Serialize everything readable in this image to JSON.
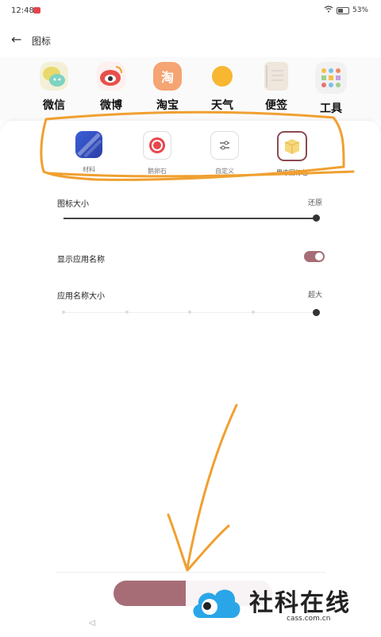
{
  "status": {
    "time": "12:48",
    "battery": "53%"
  },
  "header": {
    "title": "图标"
  },
  "preview_apps": [
    {
      "label": "微信",
      "icon": "wechat-icon"
    },
    {
      "label": "微博",
      "icon": "weibo-icon"
    },
    {
      "label": "淘宝",
      "icon": "taobao-icon",
      "glyph": "淘"
    },
    {
      "label": "天气",
      "icon": "weather-icon"
    },
    {
      "label": "便签",
      "icon": "notes-icon"
    },
    {
      "label": "工具",
      "icon": "tools-icon"
    }
  ],
  "icon_styles": [
    {
      "label": "材料",
      "icon": "material-style-icon"
    },
    {
      "label": "鹅卵石",
      "icon": "pebble-style-icon"
    },
    {
      "label": "自定义",
      "icon": "custom-style-icon"
    },
    {
      "label": "果冻图标包",
      "icon": "jelly-pack-icon"
    }
  ],
  "settings": {
    "icon_size_label": "图标大小",
    "icon_size_reset": "还原",
    "icon_size_value": 1.0,
    "show_name_label": "显示应用名称",
    "show_name_enabled": true,
    "name_size_label": "应用名称大小",
    "name_size_value": "超大",
    "name_size_step": 5,
    "name_size_steps": 5
  },
  "watermark": {
    "title": "社科在线",
    "url": "cass.com.cn"
  },
  "colors": {
    "accent": "#a76d76",
    "annotation": "#f0a030"
  }
}
